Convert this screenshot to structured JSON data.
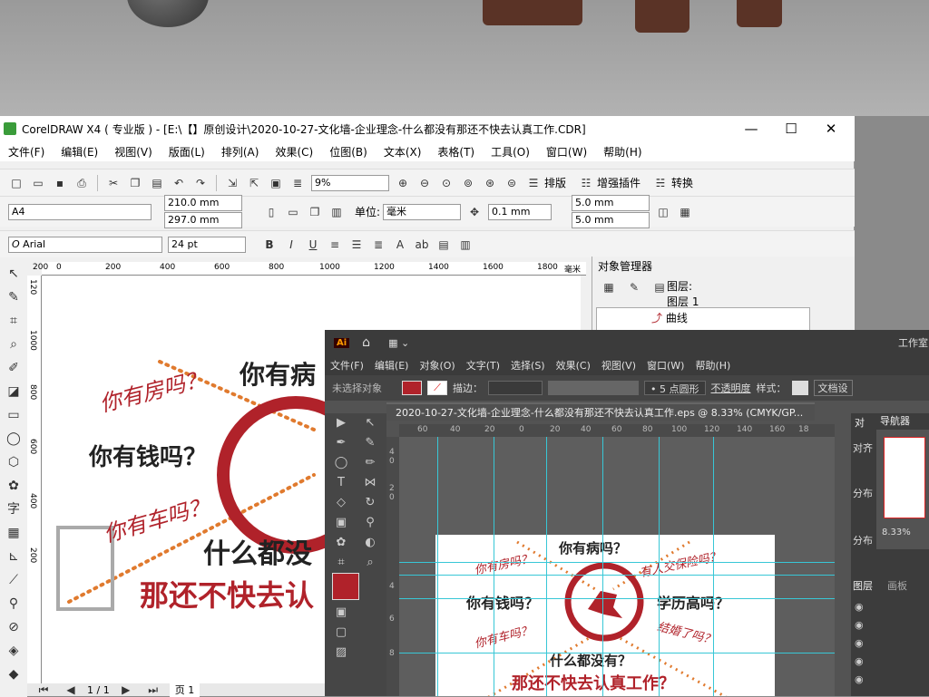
{
  "coreldraw": {
    "title": "CorelDRAW X4 ( 专业版 ) - [E:\\【】原创设计\\2020-10-27-文化墙-企业理念-什么都没有那还不快去认真工作.CDR]",
    "window_buttons": {
      "minimize": "—",
      "maximize": "☐",
      "close": "✕"
    },
    "menu": [
      "文件(F)",
      "编辑(E)",
      "视图(V)",
      "版面(L)",
      "排列(A)",
      "效果(C)",
      "位图(B)",
      "文本(X)",
      "表格(T)",
      "工具(O)",
      "窗口(W)",
      "帮助(H)"
    ],
    "zoom": "9%",
    "toolbar_labels": {
      "arrange": "排版",
      "plugins": "增强插件",
      "convert": "转换"
    },
    "page_size": "A4",
    "width": "210.0 mm",
    "height": "297.0 mm",
    "units_label": "单位:",
    "units": "毫米",
    "nudge": "0.1 mm",
    "dup_x": "5.0 mm",
    "dup_y": "5.0 mm",
    "font": "Arial",
    "font_size": "24 pt",
    "ruler_h": [
      "200",
      "0",
      "200",
      "400",
      "600",
      "800",
      "1000",
      "1200",
      "1400",
      "1600",
      "1800"
    ],
    "ruler_h_unit": "毫米",
    "ruler_v": [
      "120",
      "1000",
      "800",
      "600",
      "400",
      "200"
    ],
    "status": {
      "page": "1 / 1",
      "page_tab": "页 1"
    },
    "object_manager": {
      "title": "对象管理器",
      "layer_label": "图层:",
      "layer_value": "图层 1",
      "items": [
        "曲线"
      ]
    }
  },
  "design": {
    "q_house": "你有房吗？",
    "q_money": "你有钱吗？",
    "q_car": "你有车吗？",
    "q_sick": "你有病吗？",
    "q_degree": "学历高吗？",
    "q_insurance": "有人交保险吗？",
    "q_married": "结婚了吗？",
    "nothing": "什么都没有？",
    "slogan": "那还不快去认真工作？",
    "frag_sick": "你有病",
    "frag_nothing": "什么都没",
    "frag_slogan": "那还不快去认"
  },
  "illustrator": {
    "logo": "Ai",
    "workspace": "工作室",
    "menu": [
      "文件(F)",
      "编辑(E)",
      "对象(O)",
      "文字(T)",
      "选择(S)",
      "效果(C)",
      "视图(V)",
      "窗口(W)",
      "帮助(H)"
    ],
    "no_selection": "未选择对象",
    "stroke_label": "描边：",
    "brush": "5 点圆形",
    "opacity": "不透明度",
    "style_label": "样式：",
    "doc_settings": "文档设",
    "tab_title": "2020-10-27-文化墙-企业理念-什么都没有那还不快去认真工作.eps @ 8.33% (CMYK/GP...",
    "ruler_h": [
      "60",
      "40",
      "20",
      "0",
      "20",
      "40",
      "60",
      "80",
      "100",
      "120",
      "140",
      "160",
      "18"
    ],
    "ruler_v": [
      "4",
      "0",
      "2",
      "0",
      "4",
      "6",
      "8"
    ],
    "navigator": "导航器",
    "align_tab": "对",
    "align_label": "对齐",
    "distribute1": "分布",
    "distribute2": "分布",
    "zoom": "8.33%",
    "layers_tab": "图层",
    "artboard_tab": "画板"
  },
  "colors": {
    "brand_red": "#b0222a",
    "orange": "#e07a2e",
    "guide": "#38c7d6"
  }
}
